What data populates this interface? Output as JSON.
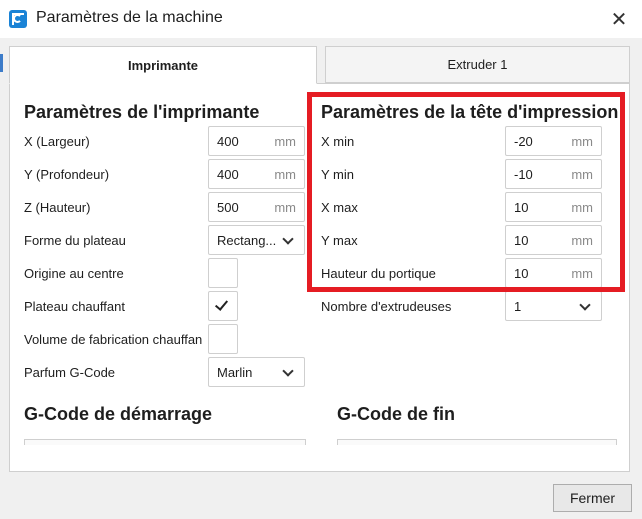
{
  "window": {
    "title": "Paramètres de la machine"
  },
  "tabs": [
    {
      "label": "Imprimante"
    },
    {
      "label": "Extruder 1"
    }
  ],
  "printer": {
    "title": "Paramètres de l'imprimante",
    "x_label": "X (Largeur)",
    "x_value": "400",
    "x_unit": "mm",
    "y_label": "Y (Profondeur)",
    "y_value": "400",
    "y_unit": "mm",
    "z_label": "Z (Hauteur)",
    "z_value": "500",
    "z_unit": "mm",
    "bed_shape_label": "Forme du plateau",
    "bed_shape_value": "Rectang...",
    "origin_label": "Origine au centre",
    "origin_checked": false,
    "heated_bed_label": "Plateau chauffant",
    "heated_bed_checked": true,
    "heated_volume_label": "Volume de fabrication chauffan",
    "heated_volume_checked": false,
    "gcode_flavor_label": "Parfum G-Code",
    "gcode_flavor_value": "Marlin"
  },
  "printhead": {
    "title": "Paramètres de la tête d'impression",
    "xmin_label": "X min",
    "xmin_value": "-20",
    "xmin_unit": "mm",
    "ymin_label": "Y min",
    "ymin_value": "-10",
    "ymin_unit": "mm",
    "xmax_label": "X max",
    "xmax_value": "10",
    "xmax_unit": "mm",
    "ymax_label": "Y max",
    "ymax_value": "10",
    "ymax_unit": "mm",
    "gantry_label": "Hauteur du portique",
    "gantry_value": "10",
    "gantry_unit": "mm",
    "extruders_label": "Nombre d'extrudeuses",
    "extruders_value": "1"
  },
  "gcode": {
    "start_title": "G-Code de démarrage",
    "end_title": "G-Code de fin"
  },
  "footer": {
    "close_label": "Fermer"
  },
  "colors": {
    "highlight": "#e51c23",
    "accent": "#1a83d6"
  }
}
